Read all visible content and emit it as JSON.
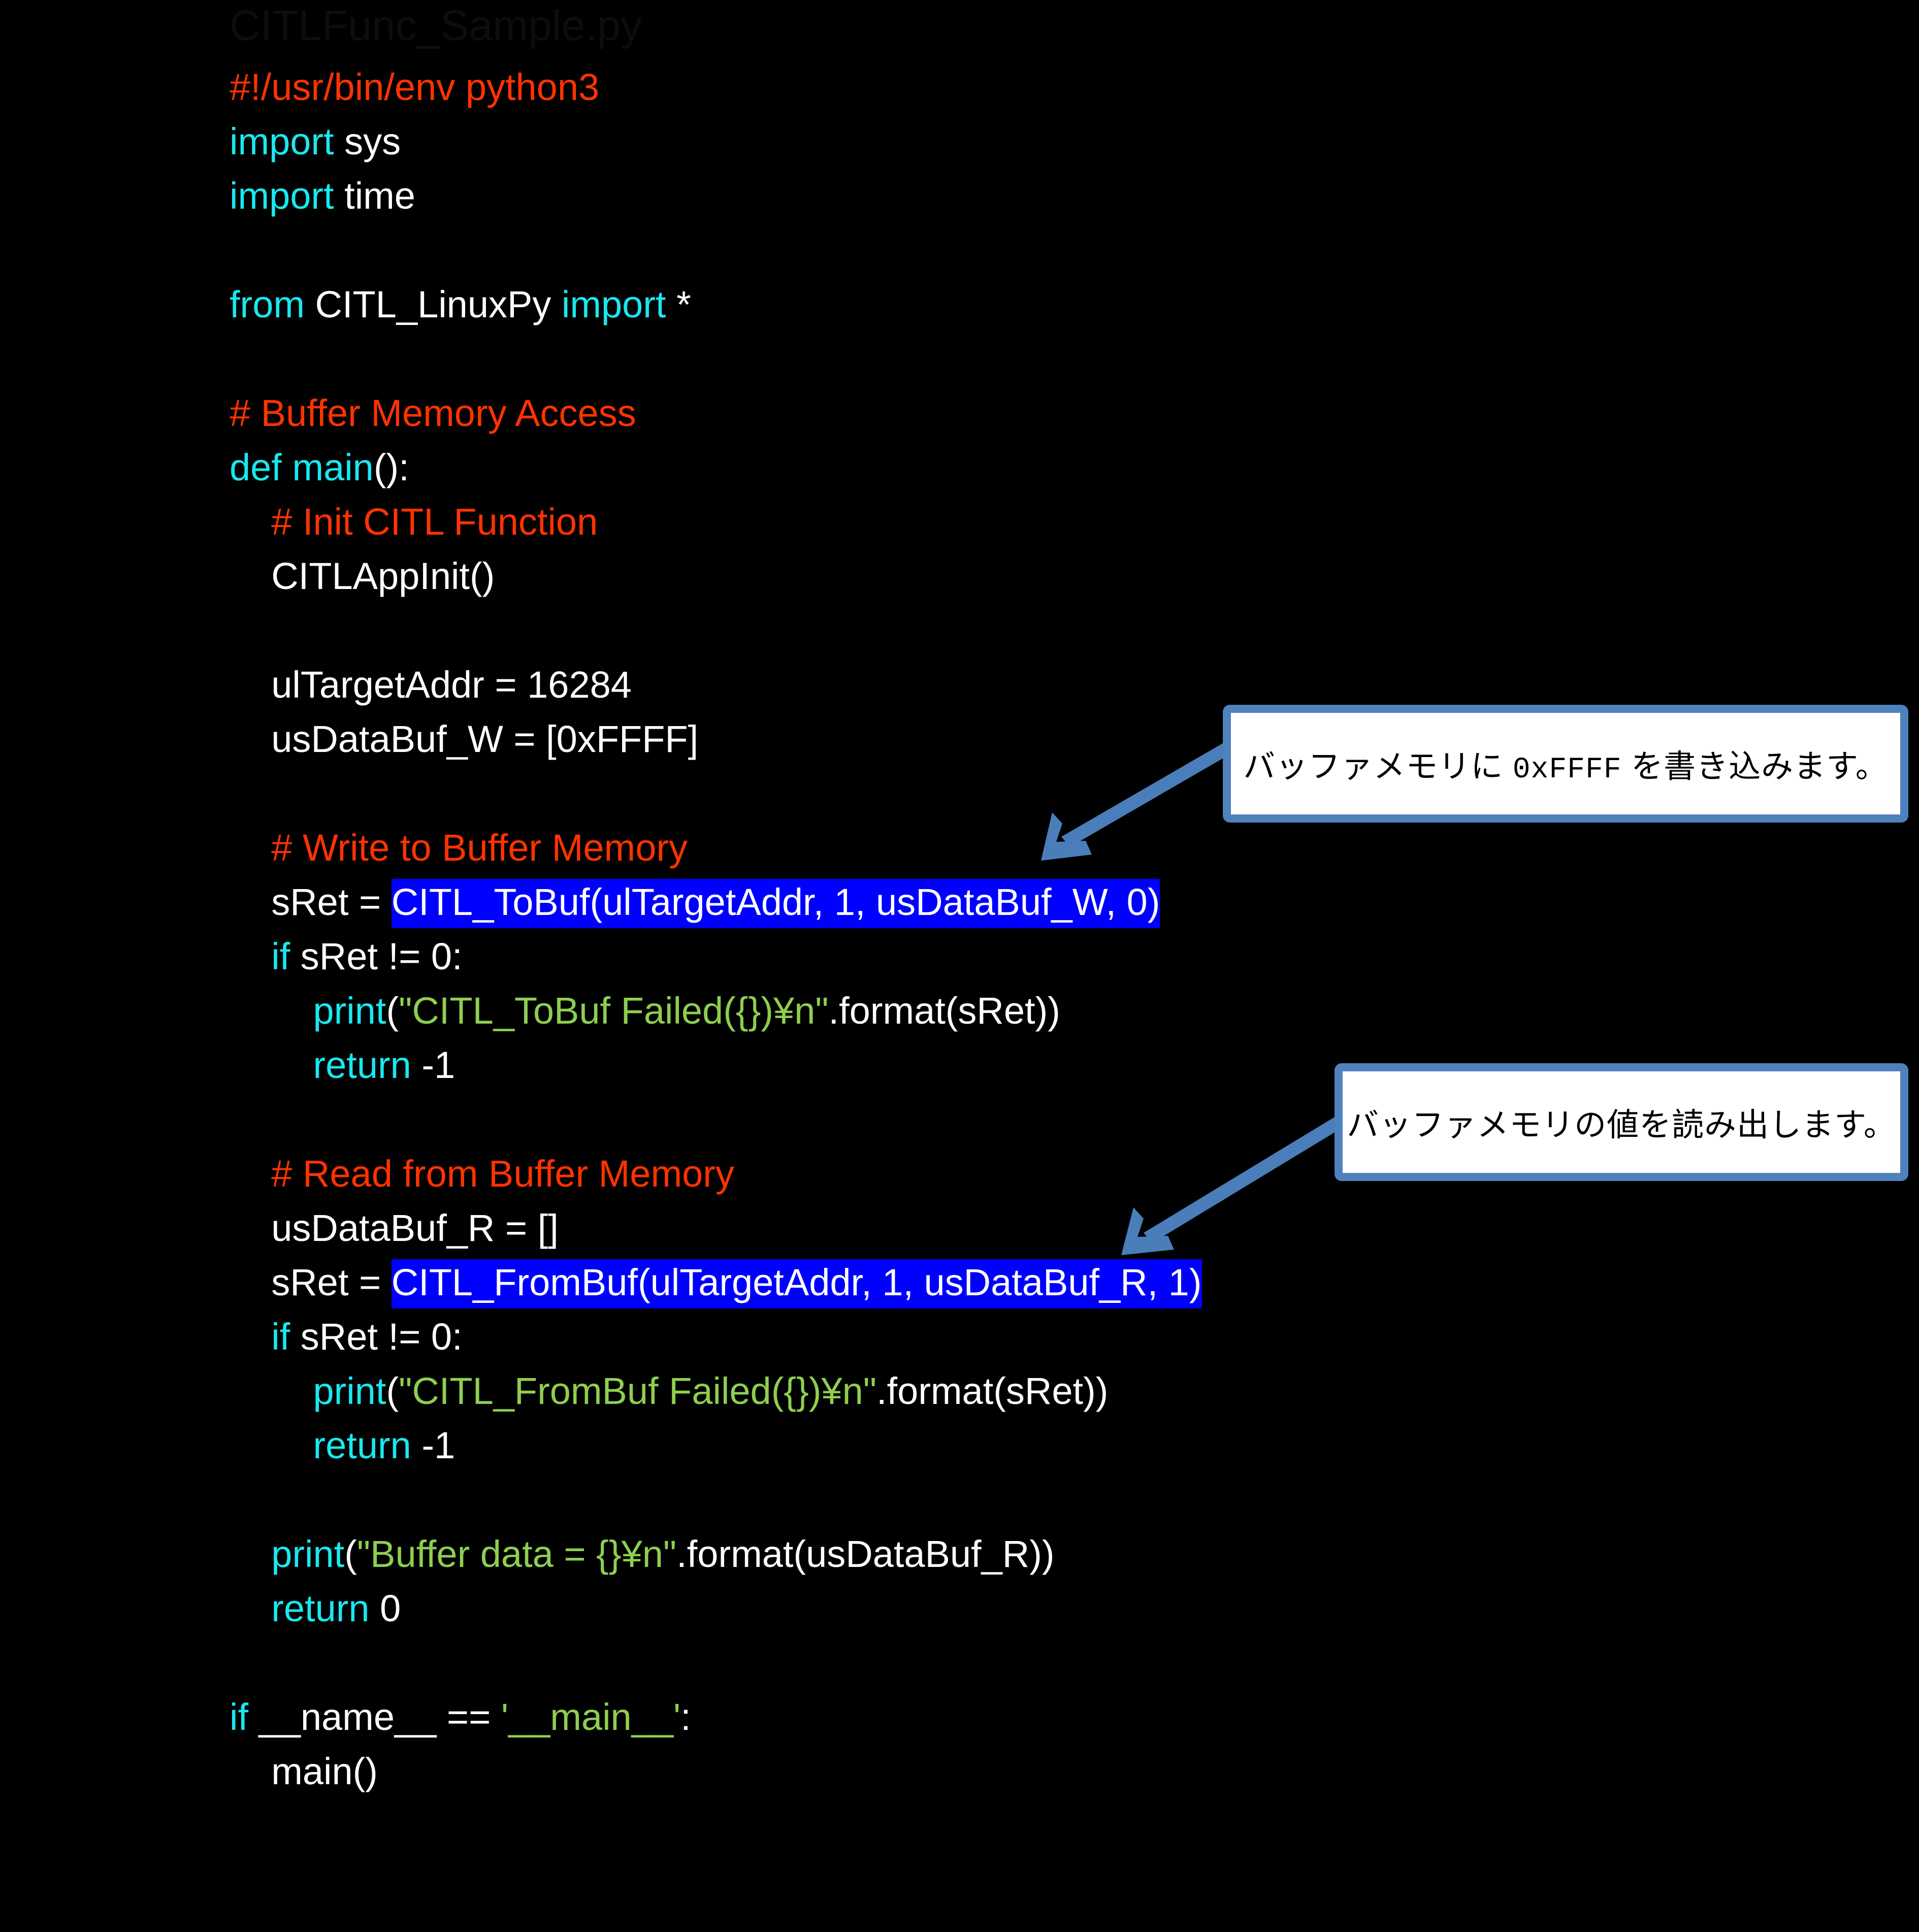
{
  "slide": {
    "title": "CITLFunc_Sample.py",
    "background_color": "#000000"
  },
  "colors": {
    "keyword": "#18E8F0",
    "comment": "#FF3300",
    "string": "#8FCE4F",
    "plain": "#FFFFFF",
    "selection_bg": "#0000FF",
    "callout_border": "#4F81BD",
    "callout_bg": "#FFFFFF",
    "arrow": "#4A7EBB"
  },
  "code": {
    "language": "python",
    "lines": [
      {
        "id": "l01",
        "segments": [
          {
            "t": "#!/usr/bin/env python3",
            "c": "comment"
          }
        ]
      },
      {
        "id": "l02",
        "segments": [
          {
            "t": "import",
            "c": "kw"
          },
          {
            "t": " sys",
            "c": "plain"
          }
        ]
      },
      {
        "id": "l03",
        "segments": [
          {
            "t": "import",
            "c": "kw"
          },
          {
            "t": " time",
            "c": "plain"
          }
        ]
      },
      {
        "id": "l04",
        "segments": [
          {
            "t": " ",
            "c": "plain"
          }
        ]
      },
      {
        "id": "l05",
        "segments": [
          {
            "t": "from",
            "c": "kw"
          },
          {
            "t": " CITL_LinuxPy ",
            "c": "plain"
          },
          {
            "t": "import",
            "c": "kw"
          },
          {
            "t": " *",
            "c": "plain"
          }
        ]
      },
      {
        "id": "l06",
        "segments": [
          {
            "t": " ",
            "c": "plain"
          }
        ]
      },
      {
        "id": "l07",
        "segments": [
          {
            "t": "# Buffer Memory Access",
            "c": "comment"
          }
        ]
      },
      {
        "id": "l08",
        "segments": [
          {
            "t": "def",
            "c": "kw"
          },
          {
            "t": " ",
            "c": "plain"
          },
          {
            "t": "main",
            "c": "kw"
          },
          {
            "t": "():",
            "c": "plain"
          }
        ]
      },
      {
        "id": "l09",
        "segments": [
          {
            "t": "    ",
            "c": "plain"
          },
          {
            "t": "# Init CITL Function",
            "c": "comment"
          }
        ]
      },
      {
        "id": "l10",
        "segments": [
          {
            "t": "    CITLAppInit()",
            "c": "plain"
          }
        ]
      },
      {
        "id": "l11",
        "segments": [
          {
            "t": " ",
            "c": "plain"
          }
        ]
      },
      {
        "id": "l12",
        "segments": [
          {
            "t": "    ulTargetAddr = 16284",
            "c": "plain"
          }
        ]
      },
      {
        "id": "l13",
        "segments": [
          {
            "t": "    usDataBuf_W = [0xFFFF]",
            "c": "plain"
          }
        ]
      },
      {
        "id": "l14",
        "segments": [
          {
            "t": " ",
            "c": "plain"
          }
        ]
      },
      {
        "id": "l15",
        "segments": [
          {
            "t": "    ",
            "c": "plain"
          },
          {
            "t": "# Write to Buffer Memory",
            "c": "comment"
          }
        ]
      },
      {
        "id": "l16",
        "segments": [
          {
            "t": "    sRet = ",
            "c": "plain"
          },
          {
            "t": "CITL_ToBuf(ulTargetAddr, 1, usDataBuf_W, 0)",
            "c": "sel"
          }
        ]
      },
      {
        "id": "l17",
        "segments": [
          {
            "t": "    ",
            "c": "plain"
          },
          {
            "t": "if",
            "c": "kw"
          },
          {
            "t": " sRet != 0:",
            "c": "plain"
          }
        ]
      },
      {
        "id": "l18",
        "segments": [
          {
            "t": "        ",
            "c": "plain"
          },
          {
            "t": "print",
            "c": "kw"
          },
          {
            "t": "(",
            "c": "plain"
          },
          {
            "t": "\"CITL_ToBuf Failed({})¥n\"",
            "c": "str"
          },
          {
            "t": ".format(sRet))",
            "c": "plain"
          }
        ]
      },
      {
        "id": "l19",
        "segments": [
          {
            "t": "        ",
            "c": "plain"
          },
          {
            "t": "return",
            "c": "kw"
          },
          {
            "t": " -1",
            "c": "plain"
          }
        ]
      },
      {
        "id": "l20",
        "segments": [
          {
            "t": " ",
            "c": "plain"
          }
        ]
      },
      {
        "id": "l21",
        "segments": [
          {
            "t": "    ",
            "c": "plain"
          },
          {
            "t": "# Read from Buffer Memory",
            "c": "comment"
          }
        ]
      },
      {
        "id": "l22",
        "segments": [
          {
            "t": "    usDataBuf_R = []",
            "c": "plain"
          }
        ]
      },
      {
        "id": "l23",
        "segments": [
          {
            "t": "    sRet = ",
            "c": "plain"
          },
          {
            "t": "CITL_FromBuf(ulTargetAddr, 1, usDataBuf_R, 1)",
            "c": "sel"
          }
        ]
      },
      {
        "id": "l24",
        "segments": [
          {
            "t": "    ",
            "c": "plain"
          },
          {
            "t": "if",
            "c": "kw"
          },
          {
            "t": " sRet != 0:",
            "c": "plain"
          }
        ]
      },
      {
        "id": "l25",
        "segments": [
          {
            "t": "        ",
            "c": "plain"
          },
          {
            "t": "print",
            "c": "kw"
          },
          {
            "t": "(",
            "c": "plain"
          },
          {
            "t": "\"CITL_FromBuf Failed({})¥n\"",
            "c": "str"
          },
          {
            "t": ".format(sRet))",
            "c": "plain"
          }
        ]
      },
      {
        "id": "l26",
        "segments": [
          {
            "t": "        ",
            "c": "plain"
          },
          {
            "t": "return",
            "c": "kw"
          },
          {
            "t": " -1",
            "c": "plain"
          }
        ]
      },
      {
        "id": "l27",
        "segments": [
          {
            "t": " ",
            "c": "plain"
          }
        ]
      },
      {
        "id": "l28",
        "segments": [
          {
            "t": "    ",
            "c": "plain"
          },
          {
            "t": "print",
            "c": "kw"
          },
          {
            "t": "(",
            "c": "plain"
          },
          {
            "t": "\"Buffer data = {}¥n\"",
            "c": "str"
          },
          {
            "t": ".format(usDataBuf_R))",
            "c": "plain"
          }
        ]
      },
      {
        "id": "l29",
        "segments": [
          {
            "t": "    ",
            "c": "plain"
          },
          {
            "t": "return",
            "c": "kw"
          },
          {
            "t": " 0",
            "c": "plain"
          }
        ]
      },
      {
        "id": "l30",
        "segments": [
          {
            "t": " ",
            "c": "plain"
          }
        ]
      },
      {
        "id": "l31",
        "segments": [
          {
            "t": "if",
            "c": "kw"
          },
          {
            "t": " __name__ == ",
            "c": "plain"
          },
          {
            "t": "'__main__'",
            "c": "str"
          },
          {
            "t": ":",
            "c": "plain"
          }
        ]
      },
      {
        "id": "l32",
        "segments": [
          {
            "t": "    main()",
            "c": "plain"
          }
        ]
      }
    ]
  },
  "callouts": [
    {
      "id": "callout-1",
      "text_prefix": "バッファメモリに ",
      "text_mono": "0xFFFF",
      "text_suffix": " を書き込みます。",
      "full_text": "バッファメモリに 0xFFFF を書き込みます。",
      "points_at": "CITL_ToBuf call"
    },
    {
      "id": "callout-2",
      "text_prefix": "バッファメモリの値を読み出します。",
      "text_mono": "",
      "text_suffix": "",
      "full_text": "バッファメモリの値を読み出します。",
      "points_at": "CITL_FromBuf call"
    }
  ]
}
